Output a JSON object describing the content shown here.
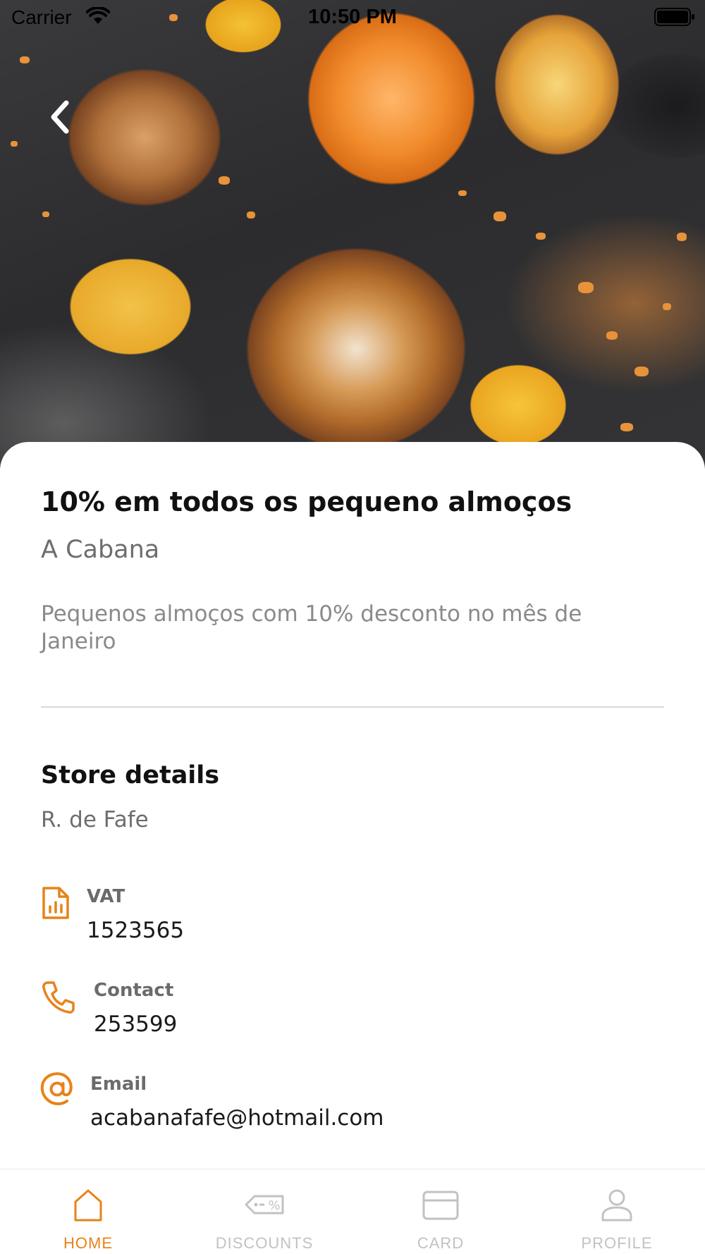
{
  "status_bar": {
    "carrier": "Carrier",
    "time": "10:50 PM"
  },
  "theme": {
    "accent": "#E8821A",
    "inactive": "#C2C2C2"
  },
  "offer": {
    "title": "10% em todos os pequeno almoços",
    "store_name": "A Cabana",
    "description": "Pequenos almoços com 10% desconto no mês de Janeiro"
  },
  "store_details": {
    "heading": "Store details",
    "address": "R. de Fafe",
    "items": [
      {
        "icon": "document-chart-icon",
        "label": "VAT",
        "value": "1523565"
      },
      {
        "icon": "phone-icon",
        "label": "Contact",
        "value": "253599"
      },
      {
        "icon": "at-sign-icon",
        "label": "Email",
        "value": "acabanafafe@hotmail.com"
      }
    ]
  },
  "tab_bar": {
    "active": "HOME",
    "tabs": [
      {
        "icon": "home-icon",
        "label": "HOME"
      },
      {
        "icon": "discount-tag-icon",
        "label": "DISCOUNTS"
      },
      {
        "icon": "card-icon",
        "label": "CARD"
      },
      {
        "icon": "profile-icon",
        "label": "PROFILE"
      }
    ]
  }
}
